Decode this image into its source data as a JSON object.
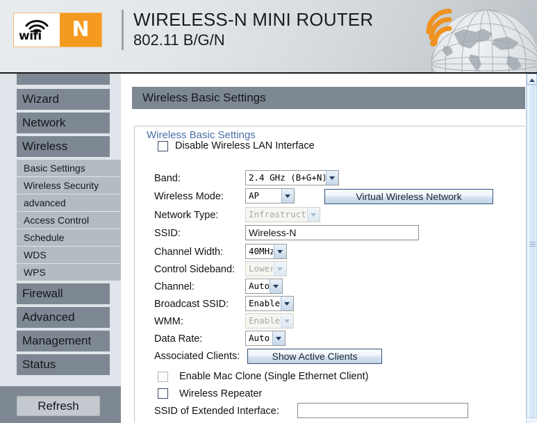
{
  "header": {
    "logo_wifi_text": "wifi",
    "logo_n_text": "N",
    "title": "WIRELESS-N MINI ROUTER",
    "subtitle": "802.11 B/G/N"
  },
  "sidebar": {
    "items": [
      {
        "label": "",
        "type": "main-clipped"
      },
      {
        "label": "Wizard",
        "type": "main"
      },
      {
        "label": "Network",
        "type": "main"
      },
      {
        "label": "Wireless",
        "type": "main"
      },
      {
        "label": "Basic Settings",
        "type": "sub"
      },
      {
        "label": "Wireless Security",
        "type": "sub"
      },
      {
        "label": "advanced",
        "type": "sub"
      },
      {
        "label": "Access Control",
        "type": "sub"
      },
      {
        "label": "Schedule",
        "type": "sub"
      },
      {
        "label": "WDS",
        "type": "sub"
      },
      {
        "label": "WPS",
        "type": "sub"
      },
      {
        "label": "Firewall",
        "type": "main"
      },
      {
        "label": "Advanced",
        "type": "main"
      },
      {
        "label": "Management",
        "type": "main"
      },
      {
        "label": "Status",
        "type": "main"
      }
    ],
    "refresh_label": "Refresh"
  },
  "main": {
    "page_title": "Wireless Basic Settings",
    "fieldset_legend": "Wireless Basic Settings",
    "disable_wlan_label": "Disable Wireless LAN Interface",
    "fields": {
      "band_label": "Band:",
      "band_value": "2.4 GHz  (B+G+N)",
      "wireless_mode_label": "Wireless Mode:",
      "wireless_mode_value": "AP",
      "virtual_network_button": "Virtual Wireless Network",
      "network_type_label": "Network Type:",
      "network_type_value": "Infrastructure",
      "ssid_label": "SSID:",
      "ssid_value": "Wireless-N",
      "channel_width_label": "Channel Width:",
      "channel_width_value": "40MHz",
      "control_sideband_label": "Control Sideband:",
      "control_sideband_value": "Lower",
      "channel_label": "Channel:",
      "channel_value": "Auto",
      "broadcast_ssid_label": "Broadcast SSID:",
      "broadcast_ssid_value": "Enabled",
      "wmm_label": "WMM:",
      "wmm_value": "Enabled",
      "data_rate_label": "Data Rate:",
      "data_rate_value": "Auto",
      "associated_clients_label": "Associated Clients:",
      "show_active_clients_button": "Show Active Clients",
      "mac_clone_label": "Enable Mac Clone (Single Ethernet Client)",
      "wireless_repeater_label": "Wireless Repeater",
      "extended_ssid_label": "SSID of Extended Interface:",
      "extended_ssid_value": ""
    }
  },
  "colors": {
    "accent_orange": "#f59a20",
    "nav_gray": "#7e8892",
    "sidebar_bg": "#dfe5ea",
    "legend_blue": "#4a6fa8"
  }
}
